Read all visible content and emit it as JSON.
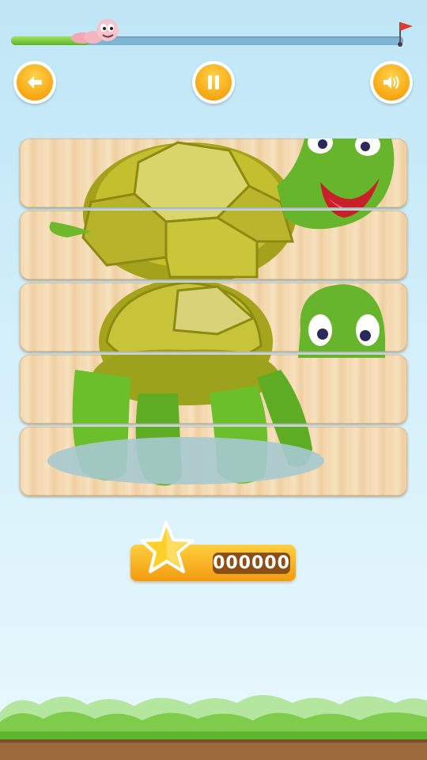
{
  "level_progress": {
    "fraction": 0.2
  },
  "buttons": {
    "back": {
      "icon": "arrow-left-icon"
    },
    "pause": {
      "icon": "pause-icon"
    },
    "sound": {
      "icon": "speaker-icon"
    }
  },
  "puzzle": {
    "subject": "turtle",
    "strip_count": 5
  },
  "score": {
    "value": "000000"
  },
  "colors": {
    "accent": "#f8a713",
    "progress_fill": "#6cc534",
    "score_box": "#8c4f13"
  }
}
